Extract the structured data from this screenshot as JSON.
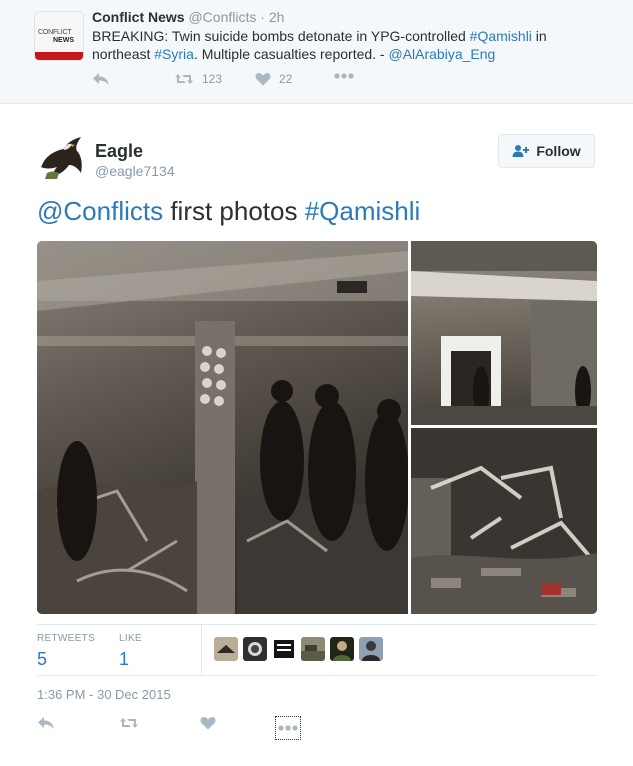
{
  "parent_tweet": {
    "avatar": {
      "logo_line1": "CONFLICT",
      "logo_line2": "NEWS",
      "brand_color": "#c8161d"
    },
    "name": "Conflict News",
    "handle": "@Conflicts",
    "separator": "·",
    "time": "2h",
    "text": {
      "part1": "BREAKING: Twin suicide bombs detonate in YPG-controlled ",
      "hashtag1": "#Qamishli",
      "part2": " in northeast ",
      "hashtag2": "#Syria",
      "part3": ". Multiple casualties reported. - ",
      "mention": "@AlArabiya_Eng"
    },
    "actions": {
      "reply_icon": "reply-icon",
      "retweet_icon": "retweet-icon",
      "retweet_count": "123",
      "like_icon": "heart-icon",
      "like_count": "22",
      "more_icon": "more-icon"
    }
  },
  "tweet": {
    "name": "Eagle",
    "handle": "@eagle7134",
    "follow_label": "Follow",
    "text": {
      "mention": "@Conflicts",
      "middle": " first photos ",
      "hashtag": "#Qamishli"
    },
    "photos": [
      {
        "desc_icon": "photo-bomb-damage-interior"
      },
      {
        "desc_icon": "photo-building-exterior"
      },
      {
        "desc_icon": "photo-debris-rubble"
      }
    ],
    "stats": {
      "retweets_label": "RETWEETS",
      "retweets_value": "5",
      "likes_label": "LIKE",
      "likes_value": "1"
    },
    "liker_avatars": 6,
    "timestamp": "1:36 PM - 30 Dec 2015"
  },
  "colors": {
    "link": "#2b7bb9",
    "muted": "#8899a6",
    "icon": "#aab8c2",
    "text": "#292f33",
    "parent_bg": "#f5f8fa"
  }
}
